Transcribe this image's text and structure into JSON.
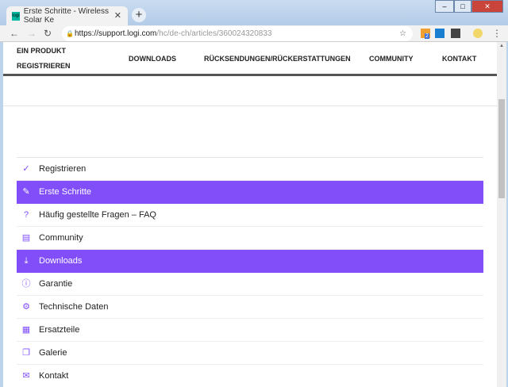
{
  "browser": {
    "tab_title": "Erste Schritte - Wireless Solar Ke",
    "favicon_text": "logi",
    "url_host": "https://support.logi.com",
    "url_path": "/hc/de-ch/articles/360024320833",
    "badge_count": "2"
  },
  "nav": {
    "items": [
      "EIN PRODUKT",
      "REGISTRIEREN",
      "DOWNLOADS",
      "RÜCKSENDUNGEN/RÜCKERSTATTUNGEN",
      "COMMUNITY",
      "KONTAKT"
    ]
  },
  "menu": {
    "accent": "#814ef9",
    "items": [
      {
        "label": "Registrieren",
        "icon": "check-icon",
        "active": false
      },
      {
        "label": "Erste Schritte",
        "icon": "pencil-icon",
        "active": true
      },
      {
        "label": "Häufig gestellte Fragen – FAQ",
        "icon": "question-icon",
        "active": false
      },
      {
        "label": "Community",
        "icon": "chat-icon",
        "active": false
      },
      {
        "label": "Downloads",
        "icon": "download-icon",
        "active": true
      },
      {
        "label": "Garantie",
        "icon": "warranty-icon",
        "active": false
      },
      {
        "label": "Technische Daten",
        "icon": "gear-icon",
        "active": false
      },
      {
        "label": "Ersatzteile",
        "icon": "grid-icon",
        "active": false
      },
      {
        "label": "Galerie",
        "icon": "gallery-icon",
        "active": false
      },
      {
        "label": "Kontakt",
        "icon": "mail-icon",
        "active": false
      }
    ]
  }
}
